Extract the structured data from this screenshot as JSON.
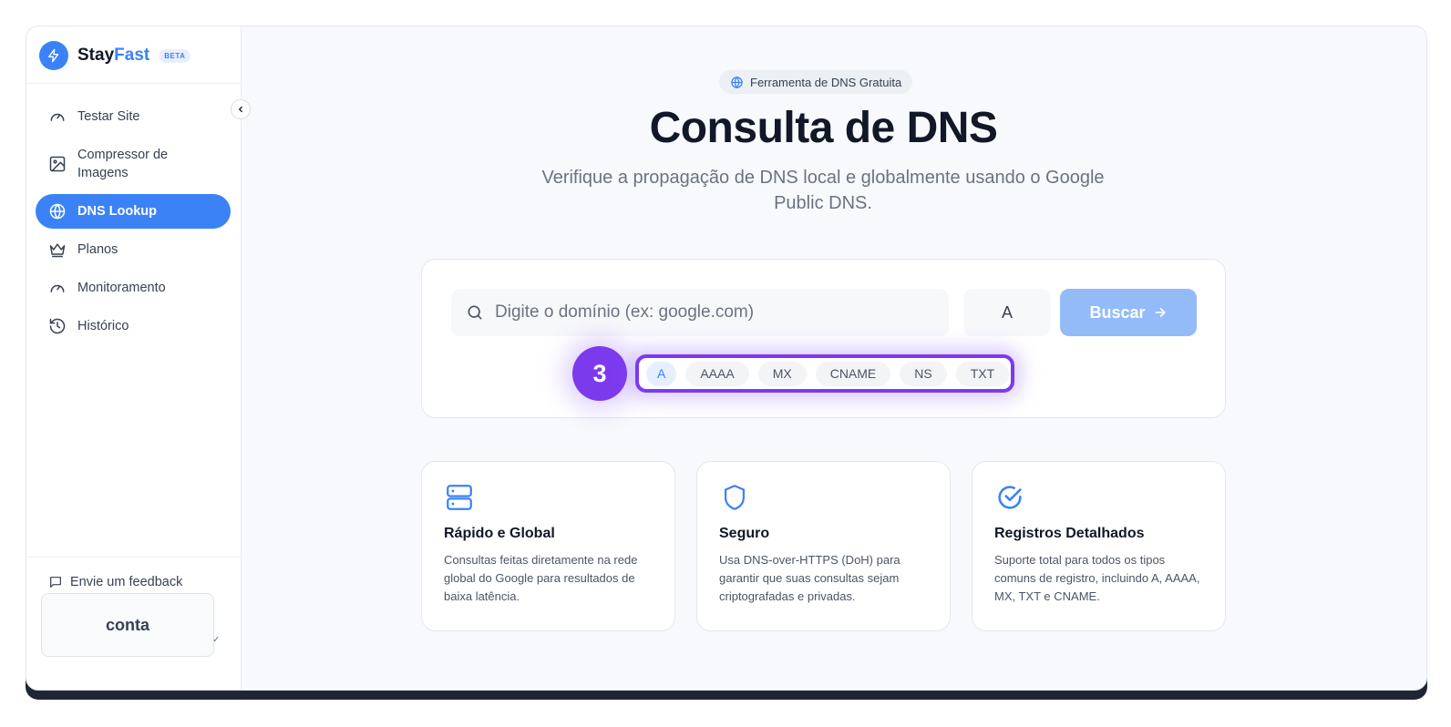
{
  "brand": {
    "name_part1": "Stay",
    "name_part2": "Fast",
    "badge": "BETA",
    "accent": "#3b82f6"
  },
  "sidebar": {
    "items": [
      {
        "label": "Testar Site",
        "icon": "gauge-icon"
      },
      {
        "label": "Compressor de Imagens",
        "icon": "image-icon"
      },
      {
        "label": "DNS Lookup",
        "icon": "globe-icon",
        "active": true
      },
      {
        "label": "Planos",
        "icon": "crown-icon"
      },
      {
        "label": "Monitoramento",
        "icon": "gauge-icon"
      },
      {
        "label": "Histórico",
        "icon": "history-icon"
      }
    ],
    "feedback": "Envie um feedback",
    "account": "conta"
  },
  "header": {
    "pill": "Ferramenta de DNS Gratuita",
    "title": "Consulta de DNS",
    "subtitle": "Verifique a propagação de DNS local e globalmente usando o Google Public DNS."
  },
  "search": {
    "placeholder": "Digite o domínio (ex: google.com)",
    "selected_type": "A",
    "button": "Buscar",
    "types": [
      "A",
      "AAAA",
      "MX",
      "CNAME",
      "NS",
      "TXT"
    ],
    "step_number": "3"
  },
  "features": [
    {
      "title": "Rápido e Global",
      "text": "Consultas feitas diretamente na rede global do Google para resultados de baixa latência.",
      "icon": "server-icon"
    },
    {
      "title": "Seguro",
      "text": "Usa DNS-over-HTTPS (DoH) para garantir que suas consultas sejam criptografadas e privadas.",
      "icon": "shield-icon"
    },
    {
      "title": "Registros Detalhados",
      "text": "Suporte total para todos os tipos comuns de registro, incluindo A, AAAA, MX, TXT e CNAME.",
      "icon": "check-circle-icon"
    }
  ]
}
